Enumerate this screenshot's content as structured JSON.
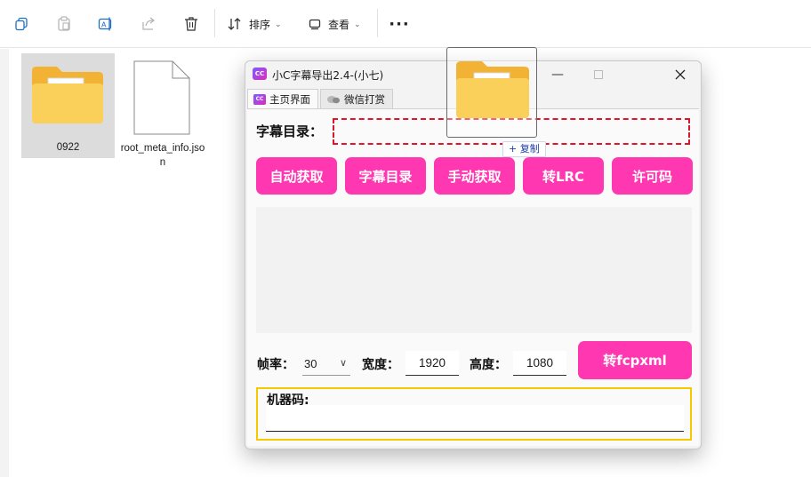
{
  "toolbar": {
    "sort_label": "排序",
    "view_label": "查看",
    "more_label": "···"
  },
  "files": [
    {
      "name": "0922",
      "icon": "folder-icon"
    },
    {
      "name": "root_meta_info.json",
      "icon": "file-icon"
    }
  ],
  "window": {
    "title": "小C字幕导出2.4-(小七)",
    "icon_text": "CC",
    "tabs": [
      {
        "label": "主页界面",
        "active": true
      },
      {
        "label": "微信打赏",
        "active": false
      }
    ]
  },
  "main": {
    "subtitle_dir_label": "字幕目录：",
    "subtitle_dir_value": "",
    "copy_tooltip": "+ 复制",
    "buttons": [
      "自动获取",
      "字幕目录",
      "手动获取",
      "转LRC",
      "许可码"
    ],
    "framerate_label": "帧率：",
    "framerate_value": "30",
    "width_label": "宽度：",
    "width_value": "1920",
    "height_label": "高度：",
    "height_value": "1080",
    "fcpxml_button": "转fcpxml",
    "machine_code_label": "机器码:",
    "machine_code_value": ""
  },
  "colors": {
    "accent_pink": "#ff38b1",
    "dashed_red": "#e0142b",
    "group_yellow": "#f5c800"
  }
}
